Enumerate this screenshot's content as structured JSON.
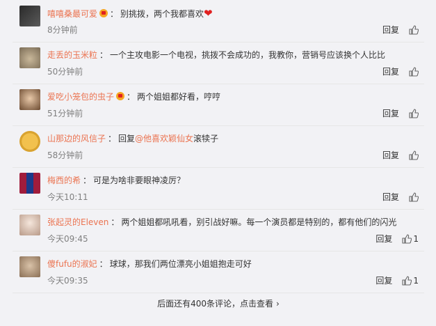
{
  "comments": [
    {
      "user": "嘻嘻桑最可爱",
      "vip": true,
      "text": "别挑拨，两个我都喜欢",
      "heart": true,
      "time": "8分钟前",
      "reply": "回复",
      "likes": ""
    },
    {
      "user": "走丢的玉米粒",
      "vip": false,
      "text": "一个主攻电影一个电视，挑拨不会成功的，我教你，营销号应该换个人比比",
      "time": "50分钟前",
      "reply": "回复",
      "likes": ""
    },
    {
      "user": "爱吃小笼包的虫子",
      "vip": true,
      "text": "两个姐姐都好看，哼哼",
      "time": "51分钟前",
      "reply": "回复",
      "likes": ""
    },
    {
      "user": "山那边的风信子",
      "vip": false,
      "text_prefix": "回复",
      "mention": "@他喜欢颖仙女",
      "text": "滚犊子",
      "time": "58分钟前",
      "reply": "回复",
      "likes": ""
    },
    {
      "user": "梅西的希",
      "vip": false,
      "text": "可是为啥非要眼神凌厉？",
      "time": "今天10:11",
      "reply": "回复",
      "likes": ""
    },
    {
      "user": "张起灵的Eleven",
      "vip": false,
      "text": "两个姐姐都吼吼看，别引战好嘛。每一个演员都是特别的，都有他们的闪光",
      "time": "今天09:45",
      "reply": "回复",
      "likes": "1"
    },
    {
      "user": "傻fufu的淑妃",
      "vip": false,
      "text": "球球，那我们两位漂亮小姐姐抱走可好",
      "time": "今天09:35",
      "reply": "回复",
      "likes": "1"
    }
  ],
  "more_label": "后面还有400条评论，点击查看",
  "colors": {
    "username": "#eb7350",
    "time": "#808080",
    "bg": "#f2f2f5"
  },
  "icons": {
    "like": "thumbs-up-icon",
    "more": "chevron-right-icon"
  }
}
